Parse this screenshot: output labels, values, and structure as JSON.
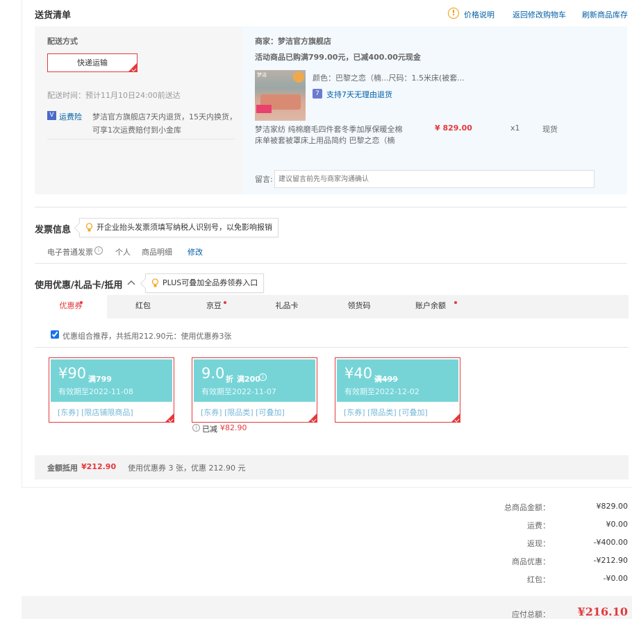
{
  "shipping": {
    "title": "送货清单",
    "links": {
      "price_note": "价格说明",
      "back_cart": "返回修改购物车",
      "refresh_stock": "刷新商品库存"
    },
    "method_label": "配送方式",
    "method_value": "快递运输",
    "delivery_time": "配送时间：预计11月10日24:00前送达",
    "insurance_label": "运费险",
    "insurance_text_1": "梦洁官方旗舰店7天内退货，15天内换货，",
    "insurance_text_2": "可享1次运费赔付到小金库"
  },
  "store": {
    "merchant": "商家：梦洁官方旗舰店",
    "promo": "活动商品已购满799.00元，已减400.00元现金",
    "attrs": "颜色：巴黎之恋（楠...尺码：1.5米床(被套...",
    "return_policy": "支持7天无理由退货",
    "product_name_1": "梦洁家纺 纯棉磨毛四件套冬季加厚保暖全棉",
    "product_name_2": "床单被套被罩床上用品简约 巴黎之恋（楠",
    "price": "¥ 829.00",
    "qty": "x1",
    "stock": "现货",
    "thumb_brand": "梦洁",
    "remark_label": "留言:",
    "remark_placeholder": "建议留言前先与商家沟通确认"
  },
  "invoice": {
    "title": "发票信息",
    "tip": "开企业抬头发票须填写纳税人识别号，以免影响报销",
    "type": "电子普通发票",
    "holder": "个人",
    "content": "商品明细",
    "edit": "修改"
  },
  "discount": {
    "title": "使用优惠/礼品卡/抵用",
    "tip": "PLUS可叠加全品券领券入口",
    "tabs": [
      {
        "label": "优惠券",
        "dot": true
      },
      {
        "label": "红包",
        "dot": false
      },
      {
        "label": "京豆",
        "dot": true
      },
      {
        "label": "礼品卡",
        "dot": false
      },
      {
        "label": "领货码",
        "dot": false
      },
      {
        "label": "账户余额",
        "dot": true
      }
    ],
    "recommend": "优惠组合推荐，共抵用212.90元：使用优惠券3张",
    "coupons": [
      {
        "amount": "¥90",
        "condition": "满799",
        "validity": "有效期至2022-11-08",
        "tags": "[东券]  [限店铺限商品]"
      },
      {
        "amount": "9.0",
        "unit": "折",
        "condition": "满200",
        "validity": "有效期至2022-11-07",
        "tags": "[东券]  [限品类]  [可叠加]"
      },
      {
        "amount": "¥40",
        "condition": "满499",
        "validity": "有效期至2022-12-02",
        "tags": "[东券]  [限品类]  [可叠加]"
      }
    ],
    "saved_label": "已减",
    "saved_value": "¥82.90",
    "total_label": "金额抵用",
    "total_value": "¥212.90",
    "total_note": "使用优惠券 3 张，优惠 212.90 元"
  },
  "summary": {
    "rows": [
      {
        "label": "总商品金额：",
        "value": "¥829.00"
      },
      {
        "label": "运费：",
        "value": "¥0.00"
      },
      {
        "label": "返现：",
        "value": "-¥400.00"
      },
      {
        "label": "商品优惠：",
        "value": "-¥212.90"
      },
      {
        "label": "红包：",
        "value": "-¥0.00"
      }
    ],
    "payable_label": "应付总额：",
    "payable_value": "¥216.10"
  },
  "colors": {
    "accent": "#e4393c",
    "link": "#005ea7",
    "coupon_bg": "#76d4d7"
  }
}
